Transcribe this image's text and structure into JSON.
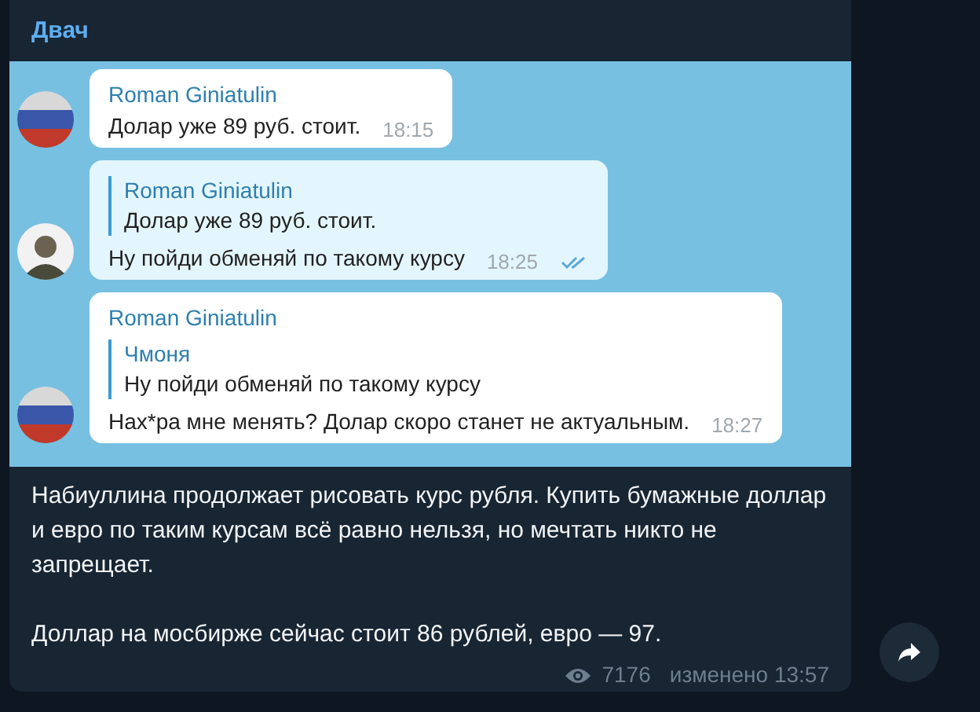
{
  "channel": {
    "title": "Двач"
  },
  "screenshot": {
    "messages": [
      {
        "kind": "flag",
        "own": false,
        "sender": "Roman Giniatulin",
        "text": "Долар уже 89 руб. стоит.",
        "time": "18:15"
      },
      {
        "kind": "person",
        "own": true,
        "reply": {
          "sender": "Roman Giniatulin",
          "text": "Долар уже 89 руб. стоит."
        },
        "text": "Ну пойди обменяй по такому курсу",
        "time": "18:25",
        "read": true
      },
      {
        "kind": "flag",
        "own": false,
        "sender": "Roman Giniatulin",
        "reply": {
          "sender": "Чмоня",
          "text": "Ну пойди обменяй по такому курсу"
        },
        "text": "Нах*ра мне менять? Долар скоро станет не актуальным.",
        "time": "18:27"
      }
    ]
  },
  "post": {
    "paragraphs": [
      "Набиуллина продолжает рисовать курс рубля. Купить бумажные доллар и евро по таким курсам всё равно нельзя, но мечтать никто не запрещает.",
      "Доллар на мосбирже сейчас стоит 86 рублей, евро — 97."
    ],
    "views": "7176",
    "edited": "изменено 13:57"
  }
}
